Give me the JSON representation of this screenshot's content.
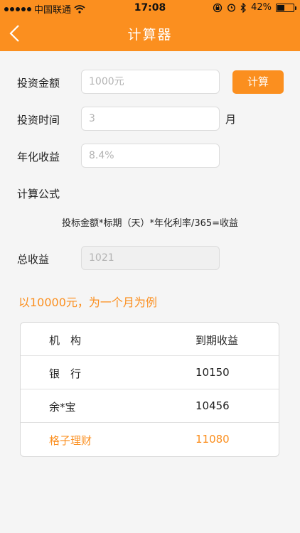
{
  "status_bar": {
    "carrier": "中国联通",
    "time": "17:08",
    "battery": "42%",
    "battery_level": 0.42
  },
  "nav": {
    "title": "计算器",
    "back_icon": "chevron-left-icon"
  },
  "form": {
    "amount": {
      "label": "投资金额",
      "placeholder": "1000元"
    },
    "calc_button": "计算",
    "period": {
      "label": "投资时间",
      "value": "3",
      "unit": "月"
    },
    "rate": {
      "label": "年化收益",
      "value": "8.4%"
    },
    "formula_label": "计算公式",
    "formula": "投标金额*标期（天）*年化利率/365=收益",
    "total": {
      "label": "总收益",
      "value": "1021"
    }
  },
  "example": {
    "title": "以10000元，为一个月为例",
    "headers": [
      "机　构",
      "到期收益"
    ],
    "rows": [
      {
        "name": "银　行",
        "value": "10150"
      },
      {
        "name": "余*宝",
        "value": "10456"
      },
      {
        "name": "格子理财",
        "value": "11080"
      }
    ]
  },
  "colors": {
    "accent": "#fb8f1f"
  }
}
